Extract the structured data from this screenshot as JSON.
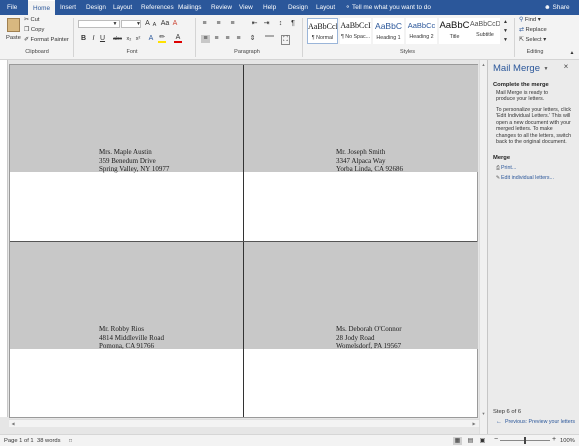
{
  "tabs": [
    "File",
    "Home",
    "Insert",
    "Design",
    "Layout",
    "References",
    "Mailings",
    "Review",
    "View",
    "Help",
    "Design",
    "Layout"
  ],
  "active_tab": "Home",
  "tell_me": "Tell me what you want to do",
  "share": "Share",
  "clipboard": {
    "paste": "Paste",
    "cut": "Cut",
    "copy": "Copy",
    "format_painter": "Format Painter",
    "label": "Clipboard"
  },
  "font": {
    "label": "Font",
    "bold": "B",
    "italic": "I",
    "underline": "U",
    "strike": "abc",
    "subscript": "x₂",
    "superscript": "x²",
    "grow": "A",
    "shrink": "A",
    "case": "Aa",
    "clear": "A",
    "color": "A"
  },
  "paragraph": {
    "label": "Paragraph",
    "pilcrow": "¶"
  },
  "styles": {
    "label": "Styles",
    "items": [
      {
        "preview": "AaBbCcI",
        "name": "¶ Normal"
      },
      {
        "preview": "AaBbCcI",
        "name": "¶ No Spac..."
      },
      {
        "preview": "AaBbC",
        "name": "Heading 1"
      },
      {
        "preview": "AaBbCc",
        "name": "Heading 2"
      },
      {
        "preview": "AaBbC",
        "name": "Title"
      },
      {
        "preview": "AaBbCcD",
        "name": "Subtitle"
      }
    ]
  },
  "editing": {
    "label": "Editing",
    "find": "Find",
    "replace": "Replace",
    "select": "Select"
  },
  "labels": [
    {
      "lines": [
        "Mrs. Maple Austin",
        "359 Benedum Drive",
        "Spring Valley, NY 10977"
      ]
    },
    {
      "lines": [
        "Mr. Joseph Smith",
        "3347 Alpaca Way",
        "Yorba Linda, CA 92686"
      ]
    },
    {
      "lines": [
        "Mr. Robby Rios",
        "4814 Middleville Road",
        "Pomona, CA 91766"
      ]
    },
    {
      "lines": [
        "Ms. Deborah O'Connor",
        "28 Jody Road",
        "Womelsdorf, PA 19567"
      ]
    }
  ],
  "pane": {
    "title": "Mail Merge",
    "complete_heading": "Complete the merge",
    "ready_text": "Mail Merge is ready to produce your letters.",
    "personalize_text": "To personalize your letters, click 'Edit Individual Letters.' This will open a new document with your merged letters. To make changes to all the letters, switch back to the original document.",
    "merge_heading": "Merge",
    "print": "Print...",
    "edit_letters": "Edit individual letters...",
    "step": "Step 6 of 6",
    "previous": "Previous: Preview your letters"
  },
  "status": {
    "page": "Page 1 of 1",
    "words": "38 words",
    "zoom": "100%"
  }
}
